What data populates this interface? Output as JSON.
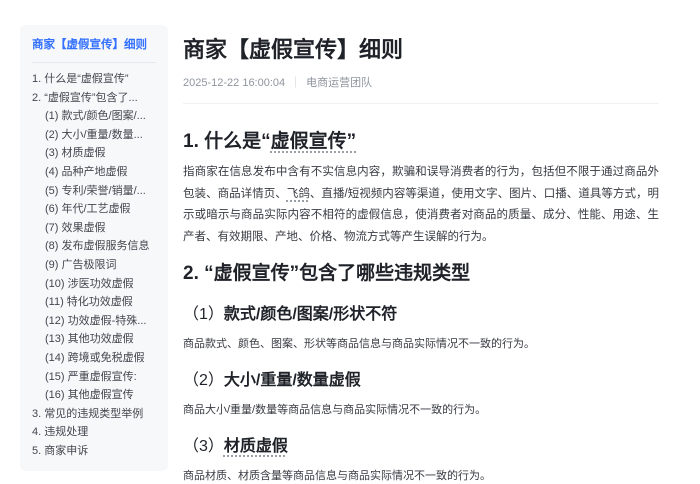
{
  "colors": {
    "accent_blue": "#3370ff",
    "sidebar_bg": "#f7f8fa",
    "heading_text": "#1f2329",
    "body_text": "#383b42",
    "meta_text": "#8f959e"
  },
  "sidebar": {
    "title": "商家【虚假宣传】细则",
    "items": [
      {
        "label": "1. 什么是“虚假宣传”"
      },
      {
        "label": "2. “虚假宣传”包含了..."
      },
      {
        "label": "(1) 款式/颜色/图案/..."
      },
      {
        "label": "(2) 大小/重量/数量..."
      },
      {
        "label": "(3) 材质虚假"
      },
      {
        "label": "(4) 品种产地虚假"
      },
      {
        "label": "(5) 专利/荣誉/销量/..."
      },
      {
        "label": "(6) 年代/工艺虚假"
      },
      {
        "label": "(7) 效果虚假"
      },
      {
        "label": "(8) 发布虚假服务信息"
      },
      {
        "label": "(9) 广告极限词"
      },
      {
        "label": "(10) 涉医功效虚假"
      },
      {
        "label": "(11) 特化功效虚假"
      },
      {
        "label": "(12) 功效虚假-特殊..."
      },
      {
        "label": "(13) 其他功效虚假"
      },
      {
        "label": "(14) 跨境或免税虚假"
      },
      {
        "label": "(15) 严重虚假宣传:"
      },
      {
        "label": "(16) 其他虚假宣传"
      },
      {
        "label": "3. 常见的违规类型举例"
      },
      {
        "label": "4. 违规处理"
      },
      {
        "label": "5. 商家申诉"
      }
    ]
  },
  "article": {
    "title": "商家【虚假宣传】细则",
    "date": "2025-12-22 16:00:04",
    "meta_sep": "｜",
    "team": "电商运营团队",
    "section1": {
      "heading_prefix": "1. 什么是“",
      "heading_term": "虚假宣传”",
      "body_a": "指商家在信息发布中含有不实信息内容，欺骗和误导消费者的行为，包括但不限于通过商品外包装、商品详情页、",
      "body_term": "飞鸽",
      "body_b": "、直播/短视频内容等渠道，使用文字、图片、口播、道具等方式，明示或暗示与商品实际内容不相符的虚假信息，使消费者对商品的质量、成分、性能、用途、生产者、有效期限、产地、价格、物流方式等产生误解的行为。"
    },
    "section2": {
      "heading": "2. “虚假宣传”包含了哪些违规类型",
      "subsections": [
        {
          "num": "（1）",
          "title": "款式/颜色/图案/形状不符",
          "body": "商品款式、颜色、图案、形状等商品信息与商品实际情况不一致的行为。"
        },
        {
          "num": "（2）",
          "title": "大小/重量/数量虚假",
          "body": "商品大小/重量/数量等商品信息与商品实际情况不一致的行为。"
        },
        {
          "num": "（3）",
          "title": "材质虚假",
          "body": "商品材质、材质含量等商品信息与商品实际情况不一致的行为。"
        }
      ]
    }
  }
}
